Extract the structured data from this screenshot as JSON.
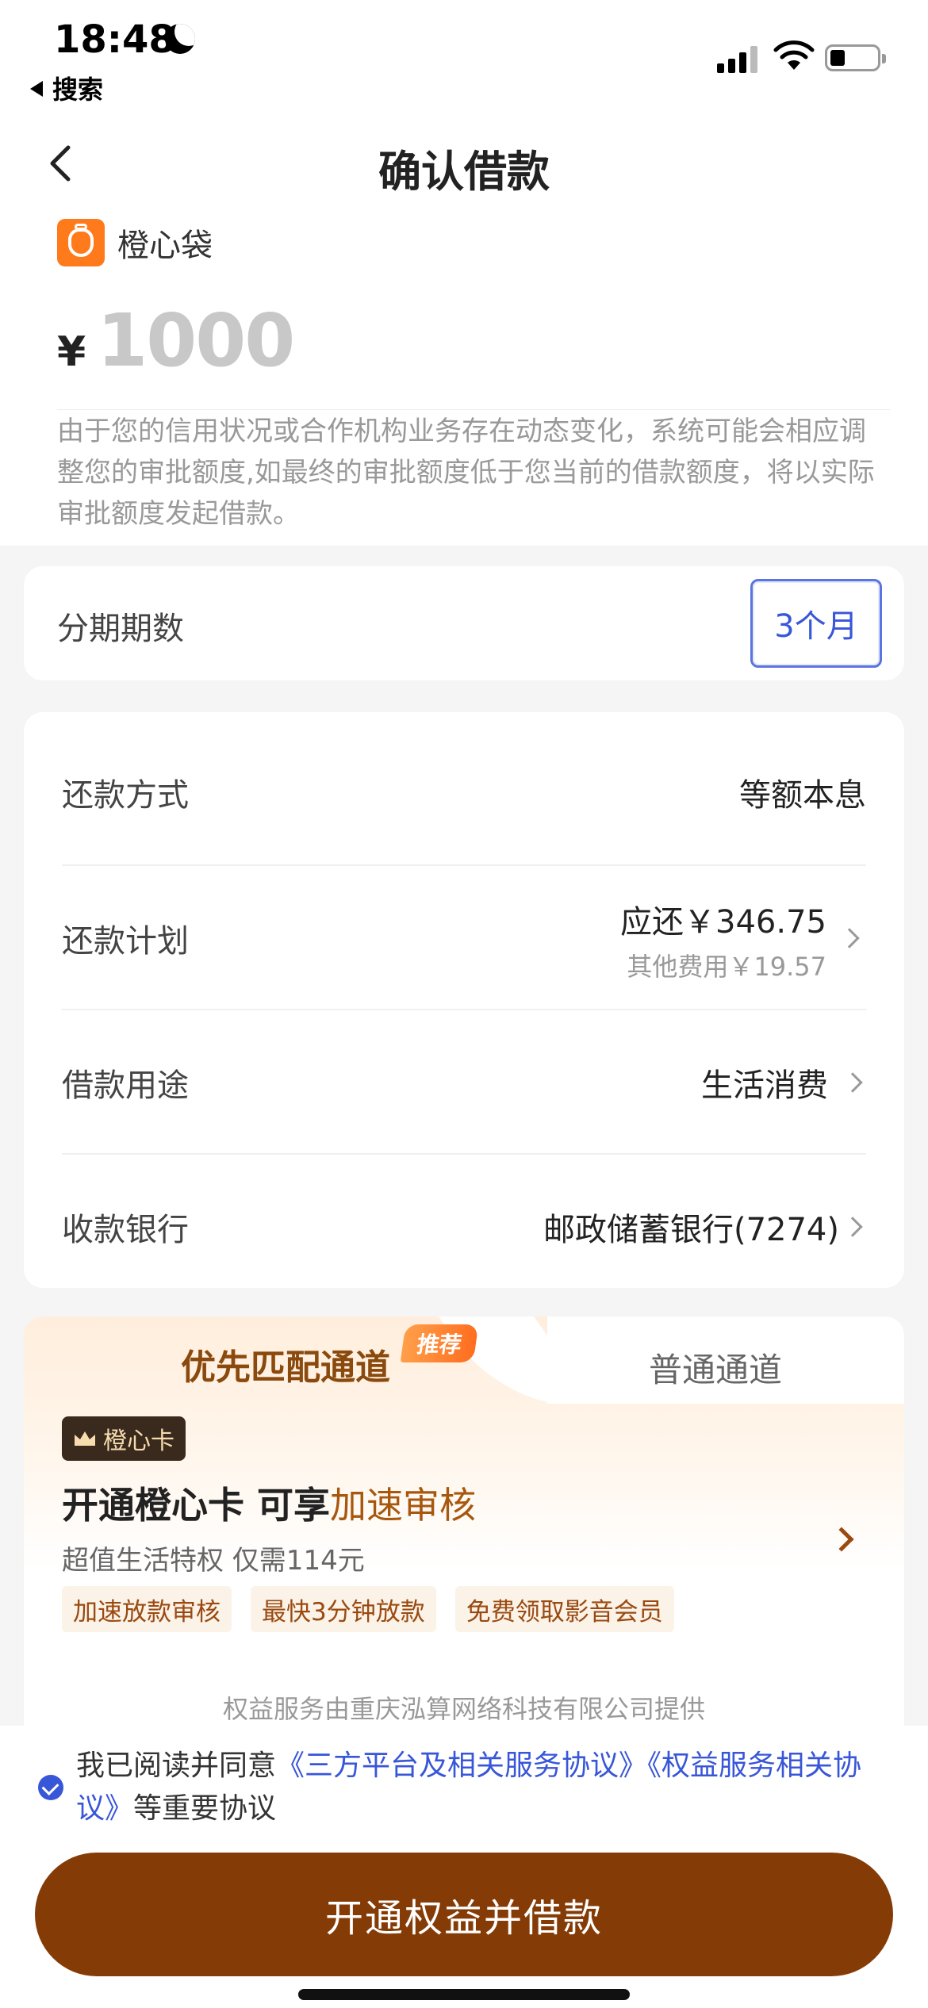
{
  "status_bar": {
    "time": "18:48",
    "back_app": "搜索"
  },
  "nav": {
    "title": "确认借款"
  },
  "brand": {
    "name": "橙心袋"
  },
  "amount": {
    "currency": "¥",
    "value": "1000"
  },
  "notice": "由于您的信用状况或合作机构业务存在动态变化，系统可能会相应调整您的审批额度,如最终的审批额度低于您当前的借款额度，将以实际审批额度发起借款。",
  "installment": {
    "label": "分期期数",
    "selected": "3个月"
  },
  "details": {
    "repay_method": {
      "label": "还款方式",
      "value": "等额本息"
    },
    "repay_plan": {
      "label": "还款计划",
      "main": "应还￥346.75",
      "sub": "其他费用￥19.57"
    },
    "purpose": {
      "label": "借款用途",
      "value": "生活消费"
    },
    "bank": {
      "label": "收款银行",
      "value": "邮政储蓄银行(7274)"
    }
  },
  "channel": {
    "active_tab": "优先匹配通道",
    "badge": "推荐",
    "inactive_tab": "普通通道",
    "vip_tag": "橙心卡",
    "title_main": "开通橙心卡 可享",
    "title_highlight": "加速审核",
    "subtitle": "超值生活特权 仅需114元",
    "perks": [
      "加速放款审核",
      "最快3分钟放款",
      "免费领取影音会员"
    ],
    "provider": "权益服务由重庆泓算网络科技有限公司提供"
  },
  "agreement": {
    "prefix": "我已阅读并同意",
    "link1": "《三方平台及相关服务协议》",
    "link2": "《权益服务相关协议》",
    "suffix": "等重要协议",
    "checked": true
  },
  "cta": {
    "label": "开通权益并借款"
  },
  "colors": {
    "accent": "#3856d8",
    "brand_brown": "#853b06",
    "brand_orange": "#ff7a1a"
  }
}
